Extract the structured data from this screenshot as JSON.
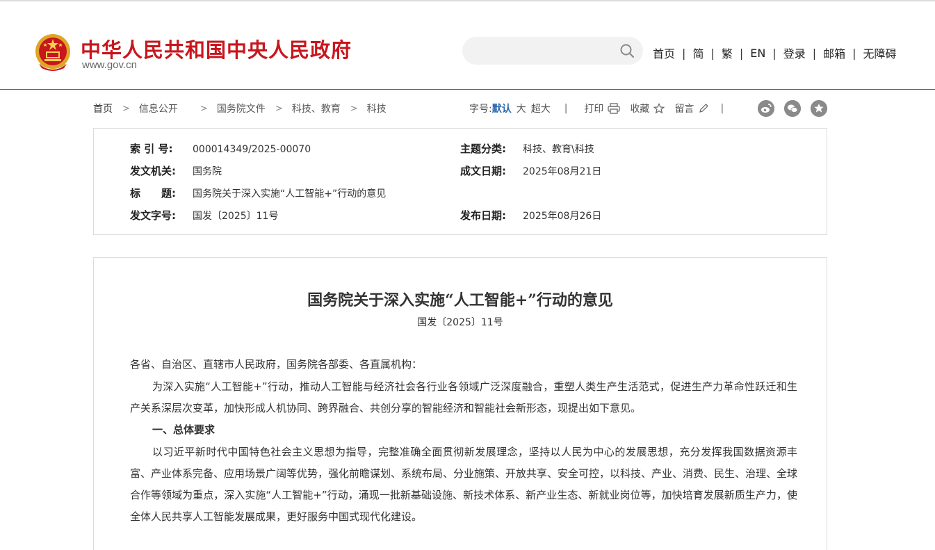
{
  "header": {
    "site_name": "中华人民共和国中央人民政府",
    "site_url": "www.gov.cn",
    "search_placeholder": "",
    "nav_links": [
      "首页",
      "简",
      "繁",
      "EN",
      "登录",
      "邮箱",
      "无障碍"
    ]
  },
  "breadcrumb": [
    "首页",
    "信息公开",
    "国务院文件",
    "科技、教育",
    "科技"
  ],
  "tools": {
    "font_label": "字号:",
    "font_default": "默认",
    "font_large": "大",
    "font_xlarge": "超大",
    "print": "打印",
    "favorite": "收藏",
    "comment": "留言"
  },
  "info": {
    "index_label": "索 引 号:",
    "index_value": "000014349/2025-00070",
    "subject_label": "主题分类:",
    "subject_value": "科技、教育\\科技",
    "issuer_label": "发文机关:",
    "issuer_value": "国务院",
    "date_made_label": "成文日期:",
    "date_made_value": "2025年08月21日",
    "title_label": "标　　题:",
    "title_value": "国务院关于深入实施“人工智能+”行动的意见",
    "docno_label": "发文字号:",
    "docno_value": "国发〔2025〕11号",
    "pub_date_label": "发布日期:",
    "pub_date_value": "2025年08月26日"
  },
  "article": {
    "title": "国务院关于深入实施“人工智能+”行动的意见",
    "doc_number": "国发〔2025〕11号",
    "salutation": "各省、自治区、直辖市人民政府，国务院各部委、各直属机构：",
    "para1": "为深入实施“人工智能+”行动，推动人工智能与经济社会各行业各领域广泛深度融合，重塑人类生产生活范式，促进生产力革命性跃迁和生产关系深层次变革，加快形成人机协同、跨界融合、共创分享的智能经济和智能社会新形态，现提出如下意见。",
    "heading1": "一、总体要求",
    "para2": "以习近平新时代中国特色社会主义思想为指导，完整准确全面贯彻新发展理念，坚持以人民为中心的发展思想，充分发挥我国数据资源丰富、产业体系完备、应用场景广阔等优势，强化前瞻谋划、系统布局、分业施策、开放共享、安全可控，以科技、产业、消费、民生、治理、全球合作等领域为重点，深入实施“人工智能+”行动，涌现一批新基础设施、新技术体系、新产业生态、新就业岗位等，加快培育发展新质生产力，使全体人民共享人工智能发展成果，更好服务中国式现代化建设。"
  },
  "colors": {
    "brand_red": "#c8161d",
    "link_blue": "#2a67b2",
    "border": "#dcdcdc"
  }
}
